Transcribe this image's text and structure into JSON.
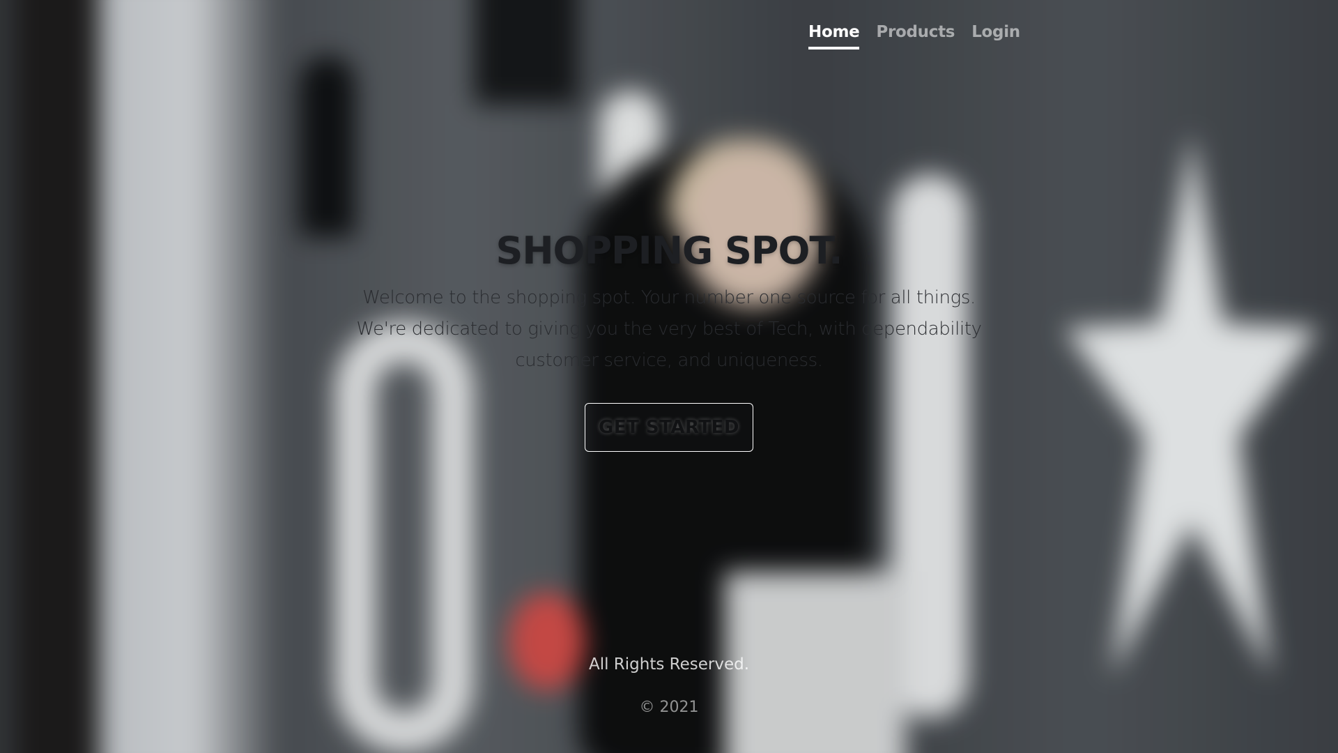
{
  "nav": {
    "items": [
      {
        "label": "Home",
        "active": true
      },
      {
        "label": "Products",
        "active": false
      },
      {
        "label": "Login",
        "active": false
      }
    ]
  },
  "hero": {
    "title": "SHOPPING SPOT.",
    "description": "Welcome to the shopping spot. Your number one source for all things. We're dedicated to giving you the very best of Tech, with dependability customer service, and uniqueness.",
    "cta_label": "GET STARTED"
  },
  "footer": {
    "rights": "All Rights Reserved.",
    "copyright": "© 2021"
  }
}
